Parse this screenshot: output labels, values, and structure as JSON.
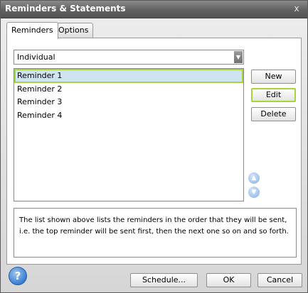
{
  "window": {
    "title": "Reminders & Statements",
    "close_glyph": "x"
  },
  "tabs": [
    {
      "label": "Reminders",
      "active": true
    },
    {
      "label": "Options",
      "active": false
    }
  ],
  "type_select": {
    "value": "Individual",
    "arrow_icon": "chevron-down-icon"
  },
  "reminders": {
    "items": [
      "Reminder 1",
      "Reminder 2",
      "Reminder 3",
      "Reminder 4"
    ],
    "selected_index": 0
  },
  "actions": {
    "new_label": "New",
    "edit_label": "Edit",
    "delete_label": "Delete",
    "move_up_icon": "arrow-up-icon",
    "move_down_icon": "arrow-down-icon"
  },
  "info": {
    "text": "The list shown above lists the reminders in the order that they will be sent, i.e. the top reminder will be sent first, then the next one so on and so forth."
  },
  "footer": {
    "help_icon": "help-icon",
    "help_glyph": "?",
    "schedule_label": "Schedule...",
    "ok_label": "OK",
    "cancel_label": "Cancel"
  },
  "colors": {
    "focus_accent": "#a6d63a",
    "selection_bg": "#cfe3f2",
    "titlebar": "#616161"
  }
}
